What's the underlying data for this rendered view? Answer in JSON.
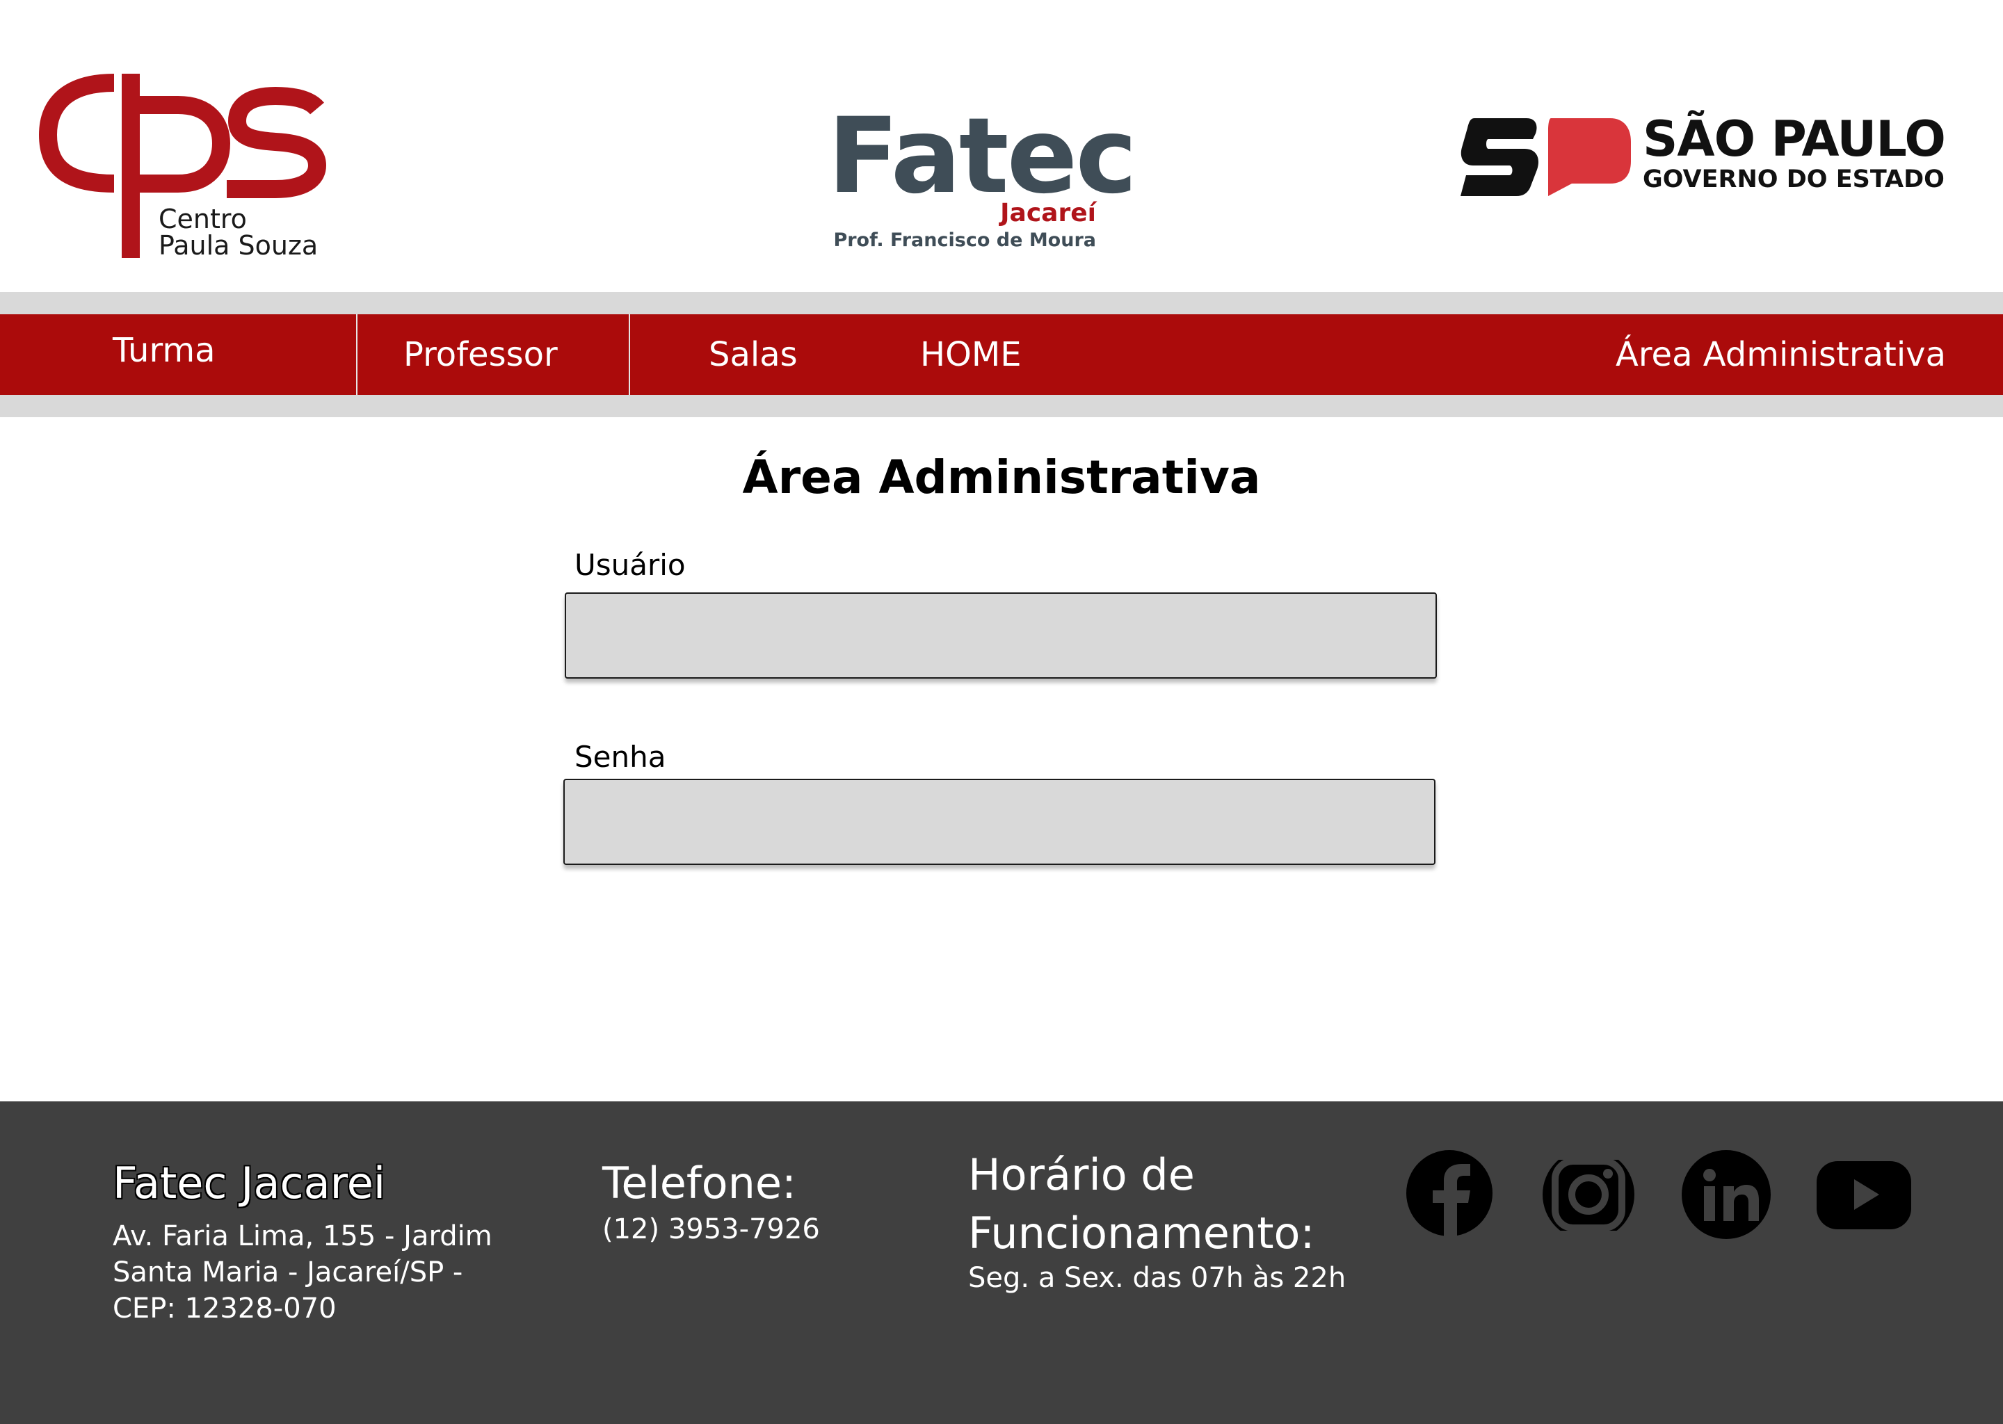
{
  "header": {
    "cps": {
      "line1": "Centro",
      "line2": "Paula Souza"
    },
    "fatec": {
      "name": "Fatec",
      "city": "Jacareí",
      "subtitle": "Prof. Francisco de Moura"
    },
    "sp": {
      "title": "SÃO PAULO",
      "subtitle": "GOVERNO DO ESTADO"
    }
  },
  "nav": {
    "items": [
      {
        "label": "Turma"
      },
      {
        "label": "Professor"
      },
      {
        "label": "Salas"
      },
      {
        "label": "HOME"
      },
      {
        "label": "Área Administrativa"
      }
    ]
  },
  "main": {
    "title": "Área Administrativa",
    "username": {
      "label": "Usuário",
      "value": "",
      "placeholder": ""
    },
    "password": {
      "label": "Senha",
      "value": "",
      "placeholder": ""
    }
  },
  "footer": {
    "org": {
      "title": "Fatec Jacarei",
      "address_line1": "Av. Faria Lima, 155 - Jardim",
      "address_line2": "Santa Maria - Jacareí/SP -",
      "address_line3": "CEP: 12328-070"
    },
    "phone": {
      "title": "Telefone:",
      "value": "(12) 3953-7926"
    },
    "hours": {
      "title_line1": "Horário de",
      "title_line2": "Funcionamento:",
      "value": "Seg. a Sex. das 07h às 22h"
    },
    "social": [
      {
        "icon": "facebook-icon"
      },
      {
        "icon": "instagram-icon"
      },
      {
        "icon": "linkedin-icon"
      },
      {
        "icon": "youtube-icon"
      }
    ]
  },
  "colors": {
    "brand_red": "#ab0b0b",
    "nav_band": "#d9d9d9",
    "footer_bg": "#404040",
    "fatec_slate": "#3f4d57",
    "input_bg": "#d9d9d9"
  }
}
